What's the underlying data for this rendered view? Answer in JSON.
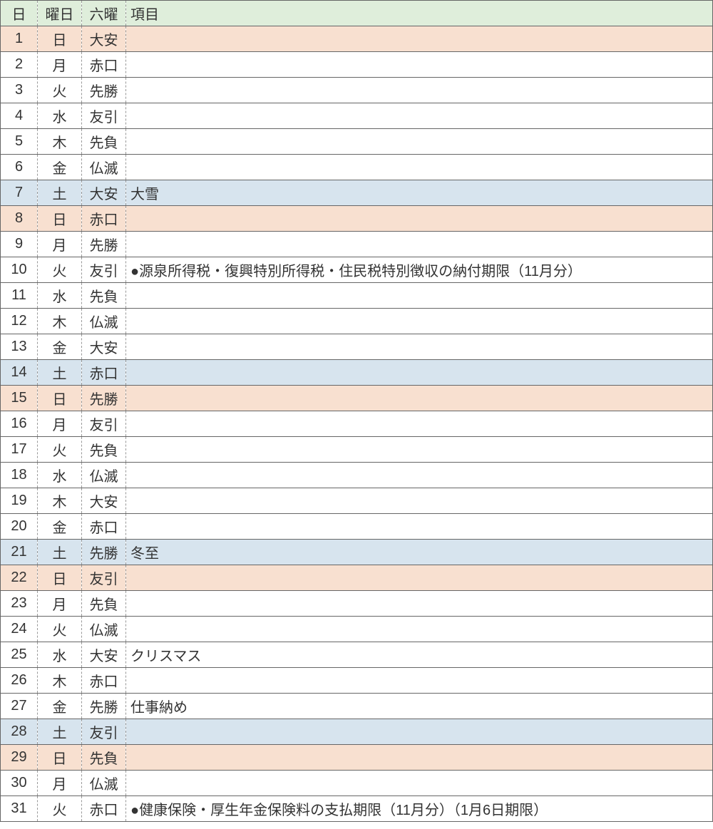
{
  "headers": {
    "day": "日",
    "wday": "曜日",
    "roku": "六曜",
    "item": "項目"
  },
  "rows": [
    {
      "day": "1",
      "wday": "日",
      "roku": "大安",
      "item": "",
      "type": "sunday"
    },
    {
      "day": "2",
      "wday": "月",
      "roku": "赤口",
      "item": "",
      "type": ""
    },
    {
      "day": "3",
      "wday": "火",
      "roku": "先勝",
      "item": "",
      "type": ""
    },
    {
      "day": "4",
      "wday": "水",
      "roku": "友引",
      "item": "",
      "type": ""
    },
    {
      "day": "5",
      "wday": "木",
      "roku": "先負",
      "item": "",
      "type": ""
    },
    {
      "day": "6",
      "wday": "金",
      "roku": "仏滅",
      "item": "",
      "type": ""
    },
    {
      "day": "7",
      "wday": "土",
      "roku": "大安",
      "item": "大雪",
      "type": "saturday"
    },
    {
      "day": "8",
      "wday": "日",
      "roku": "赤口",
      "item": "",
      "type": "sunday"
    },
    {
      "day": "9",
      "wday": "月",
      "roku": "先勝",
      "item": "",
      "type": ""
    },
    {
      "day": "10",
      "wday": "火",
      "roku": "友引",
      "item": "●源泉所得税・復興特別所得税・住民税特別徴収の納付期限（11月分）",
      "type": ""
    },
    {
      "day": "11",
      "wday": "水",
      "roku": "先負",
      "item": "",
      "type": ""
    },
    {
      "day": "12",
      "wday": "木",
      "roku": "仏滅",
      "item": "",
      "type": ""
    },
    {
      "day": "13",
      "wday": "金",
      "roku": "大安",
      "item": "",
      "type": ""
    },
    {
      "day": "14",
      "wday": "土",
      "roku": "赤口",
      "item": "",
      "type": "saturday"
    },
    {
      "day": "15",
      "wday": "日",
      "roku": "先勝",
      "item": "",
      "type": "sunday"
    },
    {
      "day": "16",
      "wday": "月",
      "roku": "友引",
      "item": "",
      "type": ""
    },
    {
      "day": "17",
      "wday": "火",
      "roku": "先負",
      "item": "",
      "type": ""
    },
    {
      "day": "18",
      "wday": "水",
      "roku": "仏滅",
      "item": "",
      "type": ""
    },
    {
      "day": "19",
      "wday": "木",
      "roku": "大安",
      "item": "",
      "type": ""
    },
    {
      "day": "20",
      "wday": "金",
      "roku": "赤口",
      "item": "",
      "type": ""
    },
    {
      "day": "21",
      "wday": "土",
      "roku": "先勝",
      "item": "冬至",
      "type": "saturday"
    },
    {
      "day": "22",
      "wday": "日",
      "roku": "友引",
      "item": "",
      "type": "sunday"
    },
    {
      "day": "23",
      "wday": "月",
      "roku": "先負",
      "item": "",
      "type": ""
    },
    {
      "day": "24",
      "wday": "火",
      "roku": "仏滅",
      "item": "",
      "type": ""
    },
    {
      "day": "25",
      "wday": "水",
      "roku": "大安",
      "item": "クリスマス",
      "type": ""
    },
    {
      "day": "26",
      "wday": "木",
      "roku": "赤口",
      "item": "",
      "type": ""
    },
    {
      "day": "27",
      "wday": "金",
      "roku": "先勝",
      "item": "仕事納め",
      "type": ""
    },
    {
      "day": "28",
      "wday": "土",
      "roku": "友引",
      "item": "",
      "type": "saturday"
    },
    {
      "day": "29",
      "wday": "日",
      "roku": "先負",
      "item": "",
      "type": "sunday"
    },
    {
      "day": "30",
      "wday": "月",
      "roku": "仏滅",
      "item": "",
      "type": ""
    },
    {
      "day": "31",
      "wday": "火",
      "roku": "赤口",
      "item": "●健康保険・厚生年金保険料の支払期限（11月分）（1月6日期限）",
      "type": ""
    }
  ]
}
